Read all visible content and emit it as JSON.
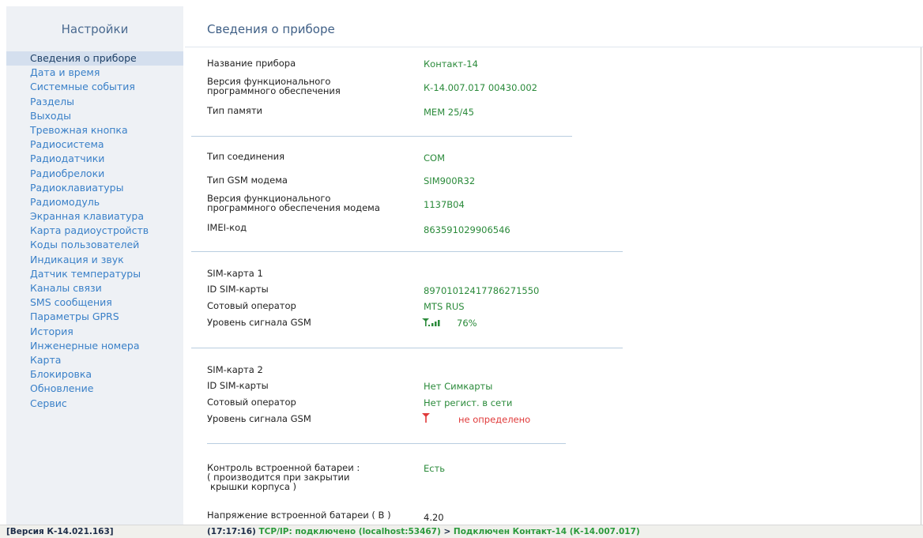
{
  "sidebar": {
    "title": "Настройки",
    "items": [
      "Сведения о приборе",
      "Дата и время",
      "Системные события",
      "Разделы",
      "Выходы",
      "Тревожная кнопка",
      "Радиосистема",
      "Радиодатчики",
      "Радиобрелоки",
      "Радиоклавиатуры",
      "Радиомодуль",
      "Экранная клавиатура",
      "Карта радиоустройств",
      "Коды пользователей",
      "Индикация и звук",
      "Датчик температуры",
      "Каналы связи",
      "SMS сообщения",
      "Параметры GPRS",
      "История",
      "Инженерные номера",
      "Карта",
      "Блокировка",
      "Обновление",
      "Сервис"
    ]
  },
  "main": {
    "title": "Сведения о приборе",
    "device": {
      "name_label": "Название прибора",
      "name_value": "Контакт-14",
      "fw_label_1": "Версия функционального",
      "fw_label_2": "программного обеспечения",
      "fw_value": "К-14.007.017 00430.002",
      "mem_label": "Тип памяти",
      "mem_value": "MEM 25/45"
    },
    "connection": {
      "type_label": "Тип соединения",
      "type_value": "COM",
      "gsm_label": "Тип GSM модема",
      "gsm_value": "SIM900R32",
      "modem_fw_label_1": "Версия функционального",
      "modem_fw_label_2": "программного обеспечения модема",
      "modem_fw_value": "1137B04",
      "imei_label": "IMEI-код",
      "imei_value": "863591029906546"
    },
    "sim1": {
      "title": "SIM-карта 1",
      "id_label": "ID SIM-карты",
      "id_value": "89701012417786271550",
      "operator_label": "Сотовый оператор",
      "operator_value": "MTS RUS",
      "signal_label": "Уровень сигнала GSM",
      "signal_value": "76%",
      "signal_icon": "signal-bars-icon"
    },
    "sim2": {
      "title": "SIM-карта 2",
      "id_label": "ID SIM-карты",
      "id_value": "Нет Симкарты",
      "operator_label": "Сотовый оператор",
      "operator_value": "Нет регист. в сети",
      "signal_label": "Уровень сигнала GSM",
      "signal_value": "не определено",
      "signal_icon": "antenna-icon"
    },
    "battery": {
      "control_label_1": "Контроль встроенной батареи :",
      "control_label_2": "( производится при закрытии",
      "control_label_3": "крышки корпуса )",
      "control_value": "Есть",
      "voltage_label": "Напряжение встроенной батареи ( В )",
      "voltage_value": "4.20"
    }
  },
  "statusbar": {
    "version": "[Версия К-14.021.163]",
    "time": "(17:17:16)",
    "tcp": " TCP/IP: подключено (localhost:53467)",
    "arrow": " > ",
    "connected": "Подключен Контакт-14 (К-14.007.017)"
  },
  "colors": {
    "accent_green": "#2a8a3a",
    "error_red": "#e03a3a",
    "link_blue": "#3a80c8"
  }
}
